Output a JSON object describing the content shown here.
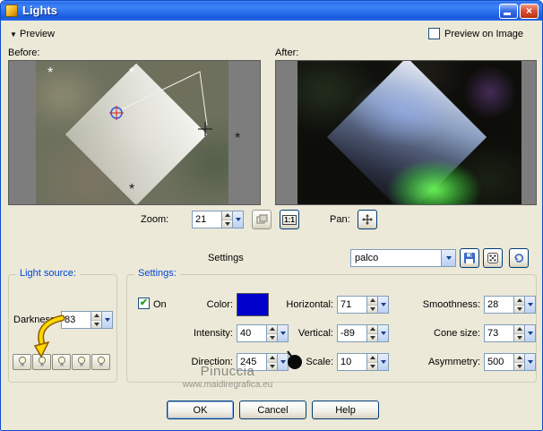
{
  "window": {
    "title": "Lights"
  },
  "toolbar": {
    "preview_label": "Preview",
    "preview_on_image_label": "Preview on Image"
  },
  "previews": {
    "before_label": "Before:",
    "after_label": "After:",
    "zoom_label": "Zoom:",
    "zoom_value": "21",
    "one_to_one_label": "1:1",
    "pan_label": "Pan:"
  },
  "presets": {
    "label": "Settings",
    "value": "palco"
  },
  "light_source": {
    "title": "Light source:",
    "darkness_label": "Darkness:",
    "darkness_value": "83"
  },
  "settings": {
    "title": "Settings:",
    "on_label": "On",
    "color_label": "Color:",
    "color_value": "#0000cc",
    "horizontal_label": "Horizontal:",
    "horizontal_value": "71",
    "smoothness_label": "Smoothness:",
    "smoothness_value": "28",
    "intensity_label": "Intensity:",
    "intensity_value": "40",
    "vertical_label": "Vertical:",
    "vertical_value": "-89",
    "cone_size_label": "Cone size:",
    "cone_size_value": "73",
    "direction_label": "Direction:",
    "direction_value": "245",
    "scale_label": "Scale:",
    "scale_value": "10",
    "asymmetry_label": "Asymmetry:",
    "asymmetry_value": "500"
  },
  "watermark": {
    "line1": "Pinuccia",
    "line2": "www.maidiregrafica.eu"
  },
  "footer": {
    "ok_label": "OK",
    "cancel_label": "Cancel",
    "help_label": "Help"
  },
  "icons": {
    "collapse_arrow": "▼",
    "checkmark": "✔",
    "close_glyph": "×",
    "asterisk": "*"
  },
  "colors": {
    "titlebar_accent": "#2a6cee",
    "dialog_background": "#ece9d8",
    "group_title": "#0046d5",
    "color_swatch": "#0000cc"
  }
}
